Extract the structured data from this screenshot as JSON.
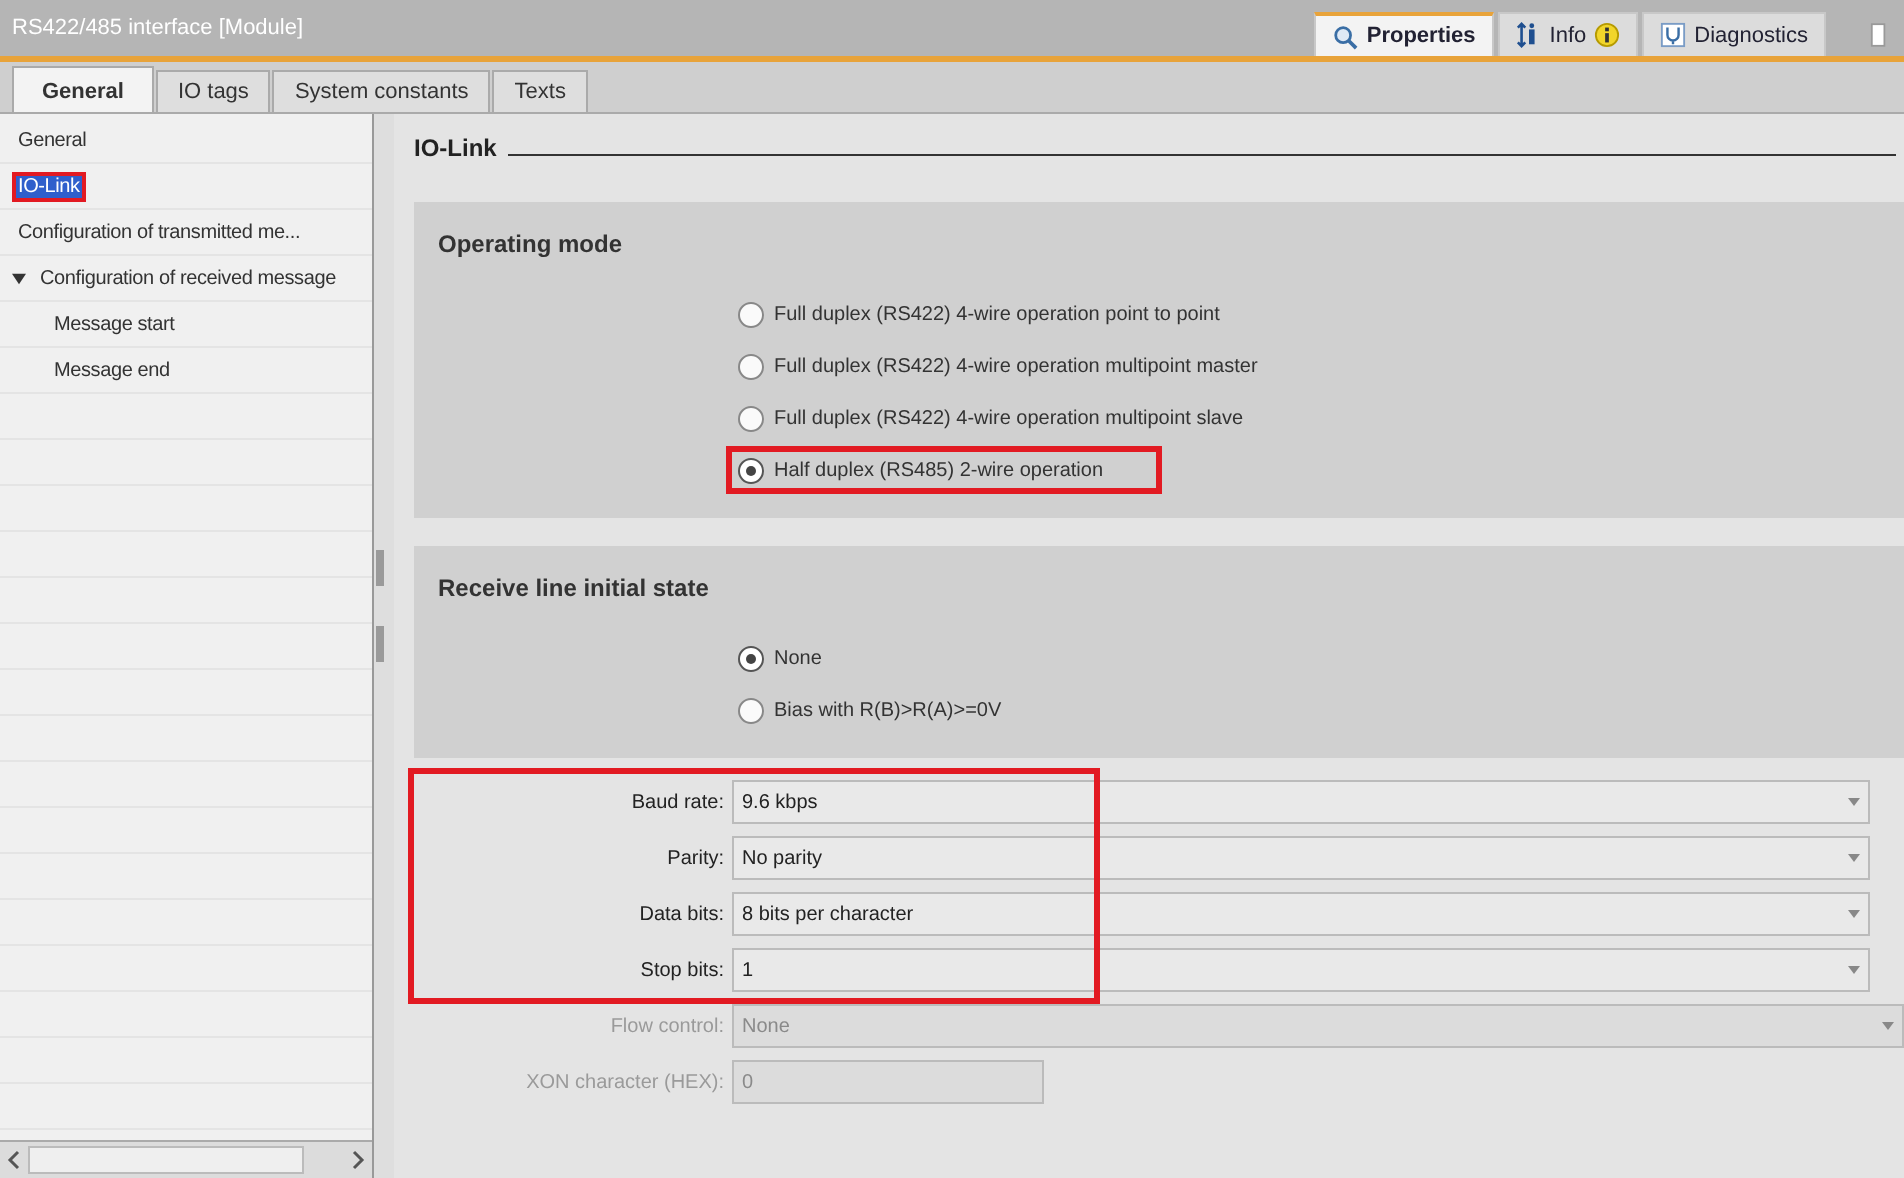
{
  "window": {
    "title": "RS422/485 interface [Module]"
  },
  "inspector_tabs": [
    {
      "label": "Properties",
      "selected": true,
      "kind": "properties"
    },
    {
      "label": "Info",
      "selected": false,
      "kind": "info"
    },
    {
      "label": "Diagnostics",
      "selected": false,
      "kind": "diagnostics"
    }
  ],
  "tabs": [
    {
      "label": "General",
      "selected": true
    },
    {
      "label": "IO tags",
      "selected": false
    },
    {
      "label": "System constants",
      "selected": false
    },
    {
      "label": "Texts",
      "selected": false
    }
  ],
  "nav": {
    "items": [
      {
        "label": "General",
        "selected": false,
        "highlighted": false
      },
      {
        "label": "IO-Link",
        "selected": true,
        "highlighted": true
      },
      {
        "label": "Configuration of transmitted me...",
        "selected": false,
        "highlighted": false
      },
      {
        "label": "Configuration of received message",
        "selected": false,
        "highlighted": false,
        "expanded": true,
        "children": [
          {
            "label": "Message start",
            "selected": false,
            "highlighted": false
          },
          {
            "label": "Message end",
            "selected": false,
            "highlighted": false
          }
        ]
      }
    ]
  },
  "content": {
    "heading": "IO-Link",
    "sections": [
      {
        "title": "Operating mode",
        "options": [
          {
            "label": "Full duplex (RS422) 4-wire operation point to point",
            "selected": false,
            "highlighted": false
          },
          {
            "label": "Full duplex (RS422) 4-wire operation multipoint master",
            "selected": false,
            "highlighted": false
          },
          {
            "label": "Full duplex (RS422) 4-wire operation multipoint slave",
            "selected": false,
            "highlighted": false
          },
          {
            "label": "Half duplex (RS485) 2-wire operation",
            "selected": true,
            "highlighted": true
          }
        ]
      },
      {
        "title": "Receive line initial state",
        "options": [
          {
            "label": "None",
            "selected": true,
            "highlighted": false
          },
          {
            "label": "Bias with R(B)>R(A)>=0V",
            "selected": false,
            "highlighted": false
          }
        ]
      }
    ],
    "field_groups": [
      {
        "highlighted": true,
        "fields": [
          {
            "label": "Baud rate:",
            "value": "9.6 kbps",
            "kind": "dropdown",
            "disabled": false
          },
          {
            "label": "Parity:",
            "value": "No parity",
            "kind": "dropdown",
            "disabled": false
          },
          {
            "label": "Data bits:",
            "value": "8 bits per character",
            "kind": "dropdown",
            "disabled": false
          },
          {
            "label": "Stop bits:",
            "value": "1",
            "kind": "dropdown",
            "disabled": false
          }
        ]
      },
      {
        "highlighted": false,
        "fields": [
          {
            "label": "Flow control:",
            "value": "None",
            "kind": "dropdown",
            "disabled": true
          },
          {
            "label": "XON character (HEX):",
            "value": "0",
            "kind": "text",
            "disabled": true
          }
        ]
      }
    ]
  }
}
